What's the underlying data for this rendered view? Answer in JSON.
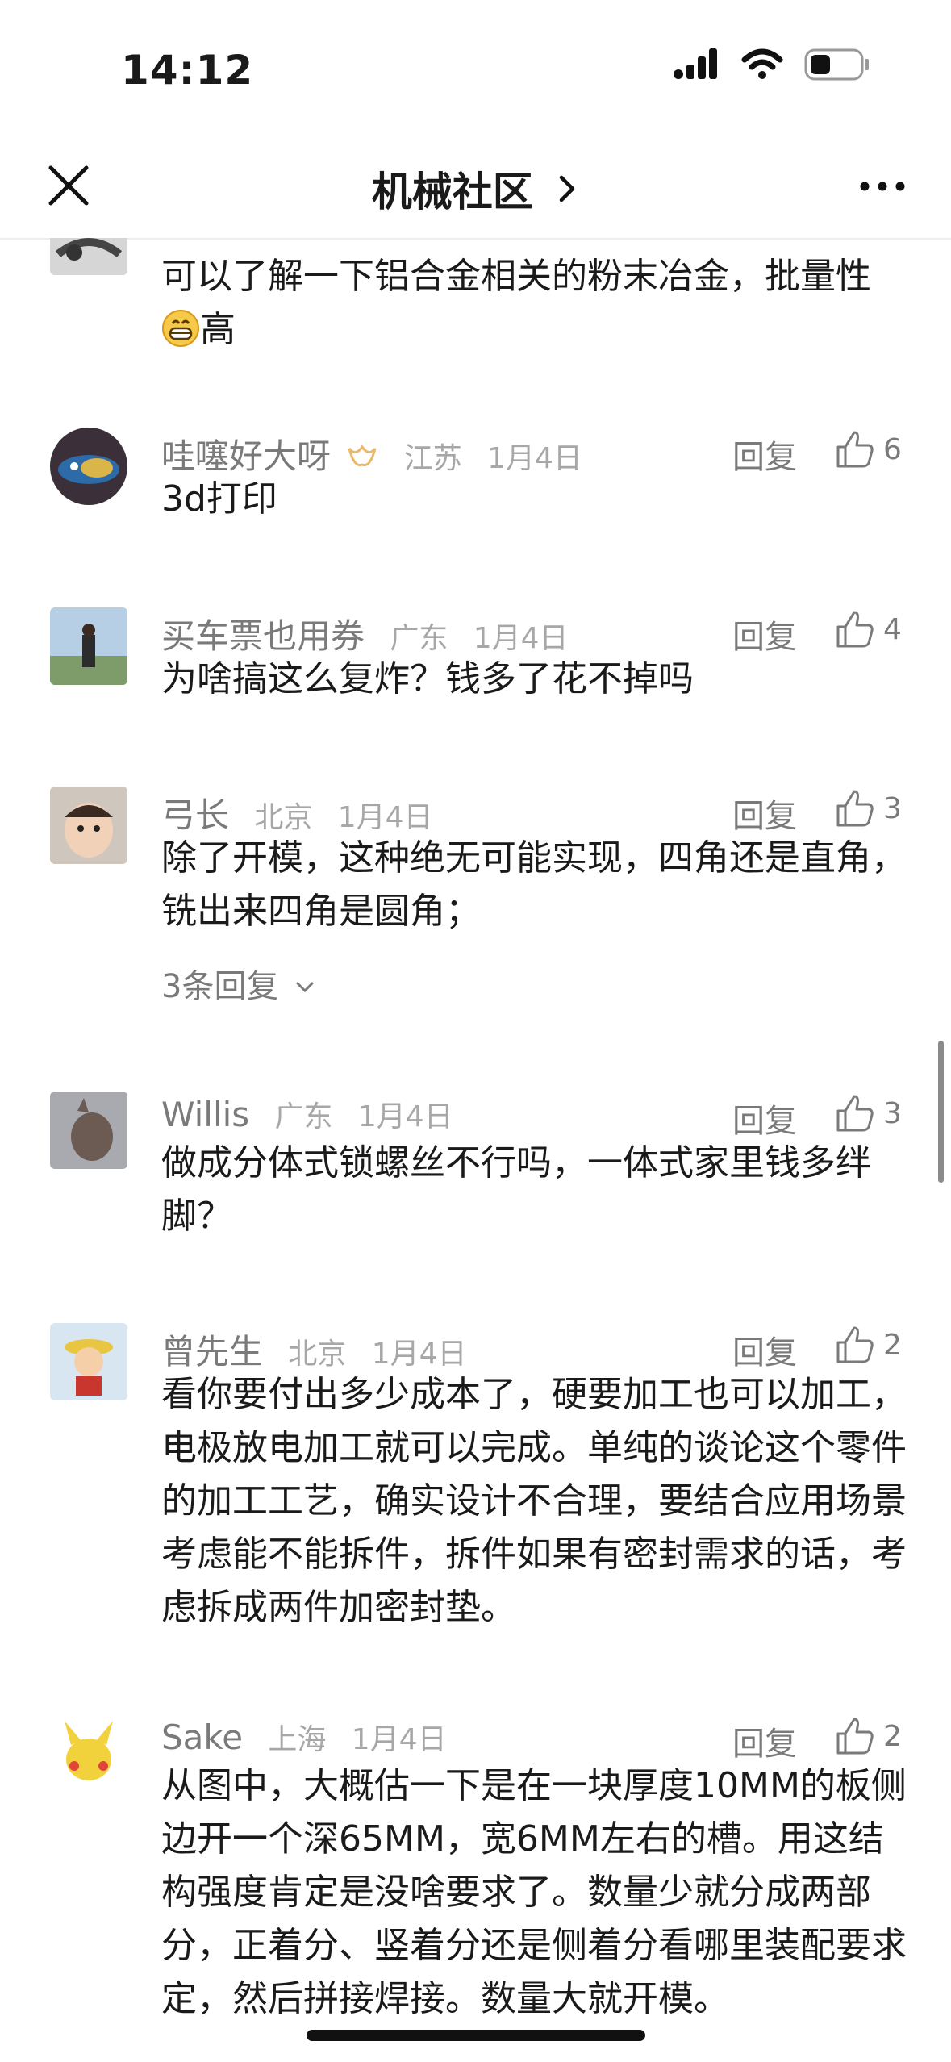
{
  "status": {
    "time": "14:12"
  },
  "nav": {
    "title": "机械社区",
    "chevron": "›"
  },
  "comments": [
    {
      "text_pre": "可以了解一下铝合金相关的粉末冶金，批量性",
      "text_post": "高",
      "emoji": "grinning-emoji"
    },
    {
      "name": "哇噻好大呀",
      "badge": "crown-badge-icon",
      "region": "江苏",
      "date": "1月4日",
      "reply": "回复",
      "likes": "6",
      "text": "3d打印"
    },
    {
      "name": "买车票也用券",
      "region": "广东",
      "date": "1月4日",
      "reply": "回复",
      "likes": "4",
      "text": "为啥搞这么复炸？钱多了花不掉吗"
    },
    {
      "name": "弓长",
      "region": "北京",
      "date": "1月4日",
      "reply": "回复",
      "likes": "3",
      "text": "除了开模，这种绝无可能实现，四角还是直角，铣出来四角是圆角；",
      "more_replies": "3条回复"
    },
    {
      "name": "Willis",
      "region": "广东",
      "date": "1月4日",
      "reply": "回复",
      "likes": "3",
      "text": "做成分体式锁螺丝不行吗，一体式家里钱多绊脚？"
    },
    {
      "name": "曾先生",
      "region": "北京",
      "date": "1月4日",
      "reply": "回复",
      "likes": "2",
      "text": "看你要付出多少成本了，硬要加工也可以加工，电极放电加工就可以完成。单纯的谈论这个零件的加工工艺，确实设计不合理，要结合应用场景考虑能不能拆件，拆件如果有密封需求的话，考虑拆成两件加密封垫。"
    },
    {
      "name": "Sake",
      "region": "上海",
      "date": "1月4日",
      "reply": "回复",
      "likes": "2",
      "text": "从图中，大概估一下是在一块厚度10MM的板侧边开一个深65MM，宽6MM左右的槽。用这结构强度肯定是没啥要求了。数量少就分成两部分，正着分、竖着分还是侧着分看哪里装配要求定，然后拼接焊接。数量大就开模。"
    }
  ]
}
